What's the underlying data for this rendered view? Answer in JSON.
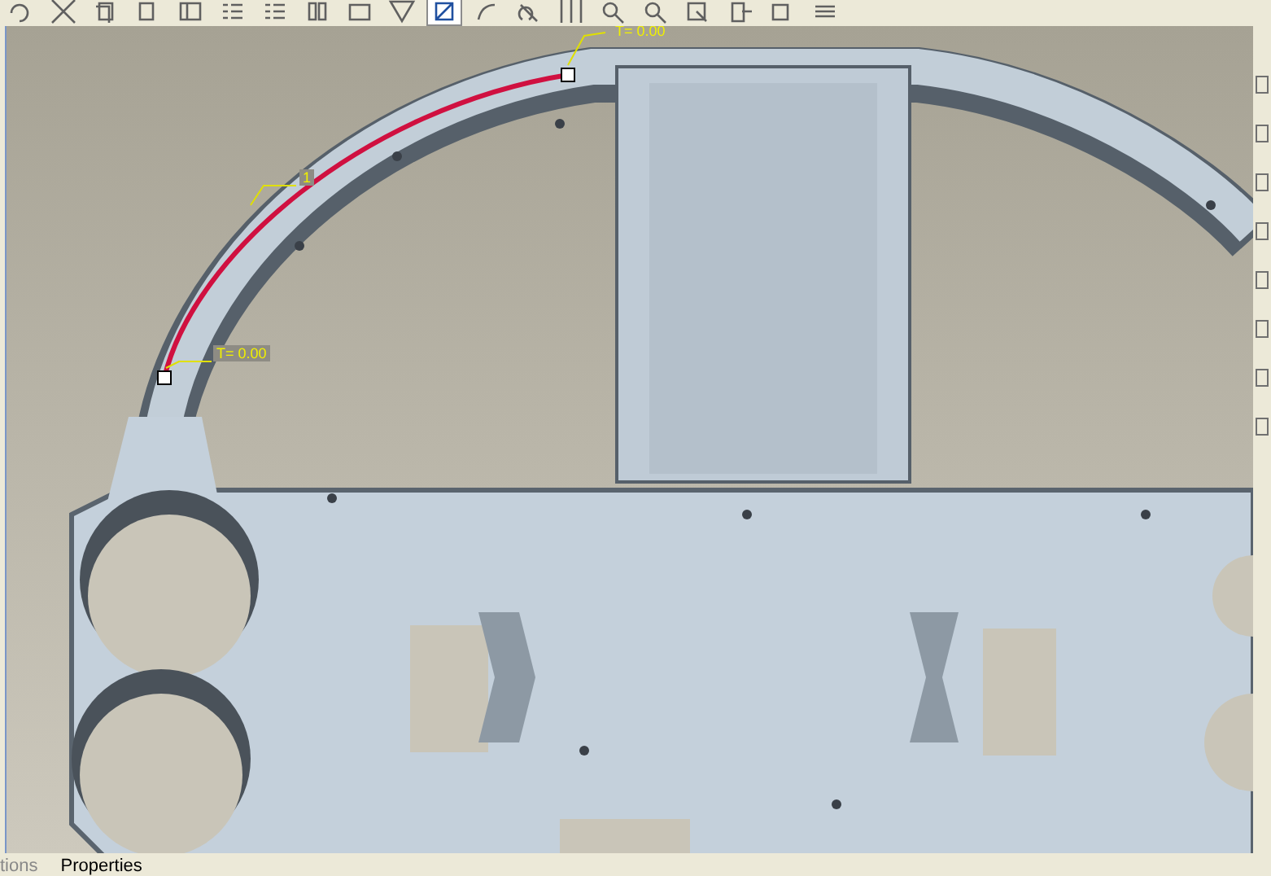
{
  "toolbar": {
    "buttons": [
      {
        "selected": false
      },
      {
        "selected": false
      },
      {
        "selected": false
      },
      {
        "selected": false
      },
      {
        "selected": false
      },
      {
        "selected": false
      },
      {
        "selected": false
      },
      {
        "selected": false
      },
      {
        "selected": false
      },
      {
        "selected": false
      },
      {
        "selected": true
      },
      {
        "selected": false
      },
      {
        "selected": false
      },
      {
        "selected": false
      },
      {
        "selected": false
      },
      {
        "selected": false
      },
      {
        "selected": false
      },
      {
        "selected": false
      },
      {
        "selected": false
      },
      {
        "selected": false
      }
    ]
  },
  "viewport": {
    "annotations": [
      {
        "text": "T= 0.00"
      },
      {
        "text": "1"
      },
      {
        "text": "T= 0.00"
      }
    ]
  },
  "bottom_tabs": [
    {
      "label": "tions",
      "selected": false
    },
    {
      "label": "Properties",
      "selected": true
    }
  ]
}
